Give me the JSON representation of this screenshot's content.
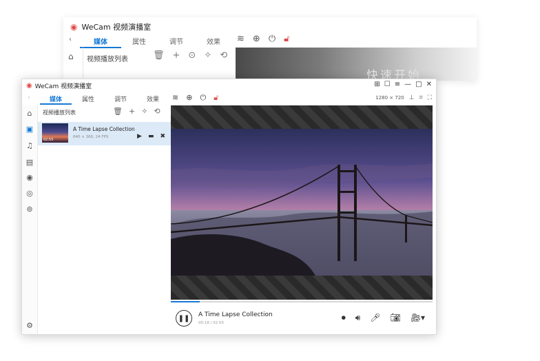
{
  "background_window": {
    "title": "WeCam 视频演播室",
    "tabs": [
      "媒体",
      "属性",
      "调节",
      "效果"
    ],
    "list_title": "视频播放列表",
    "preview_text": "快速开始"
  },
  "window": {
    "title": "WeCam 视频演播室",
    "controls": [
      "⊞",
      "☐",
      "≡",
      "—",
      "□",
      "✕"
    ]
  },
  "tabs": [
    {
      "label": "媒体"
    },
    {
      "label": "属性"
    },
    {
      "label": "调节"
    },
    {
      "label": "效果"
    }
  ],
  "toolbar": {
    "resolution": "1280 × 720"
  },
  "playlist": {
    "title": "视频播放列表",
    "items": [
      {
        "title": "A Time Lapse Collection",
        "info": "640 × 360, 24 FPS",
        "thumb_time": "02:55"
      }
    ]
  },
  "player": {
    "title": "A Time Lapse Collection",
    "time": "00:18 / 02:55",
    "progress": 0.11
  },
  "colors": {
    "accent": "#1678d4",
    "record_red": "#e04a4a"
  }
}
